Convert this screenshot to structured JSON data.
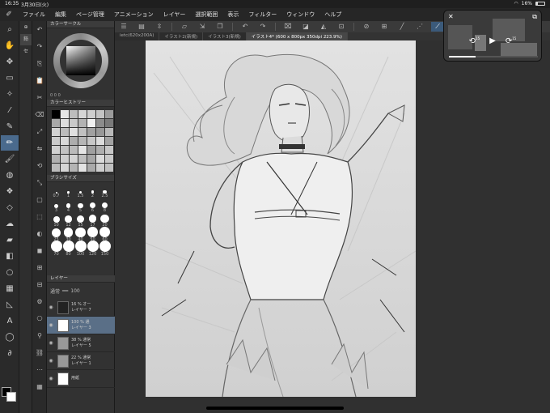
{
  "status": {
    "time": "16:35",
    "date": "3月30日(火)",
    "battery": "16%"
  },
  "menu": [
    "ファイル",
    "編集",
    "ページ管理",
    "アニメーション",
    "レイヤー",
    "選択範囲",
    "表示",
    "フィルター",
    "ウィンドウ",
    "ヘルプ"
  ],
  "tabs": [
    "ietc(620x200A)",
    "イラスト2(新規)",
    "イラスト3(新規)",
    "イラスト4* (600 x 800px 350dpi 223.9%)"
  ],
  "palette": {
    "color_circle_title": "カラーサークル",
    "history_title": "カラーヒストリー",
    "brush_title": "ブラシサイズ",
    "layer_title": "レイヤー",
    "blend_mode": "通常",
    "opacity": "100",
    "color_values": [
      "0",
      "0",
      "0"
    ]
  },
  "brush_sizes": [
    "0.7",
    "1",
    "1.5",
    "2",
    "2.5",
    "3",
    "4",
    "5",
    "6",
    "8",
    "10",
    "12",
    "15",
    "17",
    "20",
    "25",
    "30",
    "40",
    "50",
    "60",
    "70",
    "80",
    "100",
    "120",
    "150",
    "170",
    "200",
    "250",
    "300"
  ],
  "layers": [
    {
      "opacity_mode": "16 % オー",
      "name": "レイヤー 7",
      "thumb": "dark",
      "active": false
    },
    {
      "opacity_mode": "100 % 通",
      "name": "レイヤー 3",
      "thumb": "white",
      "active": true
    },
    {
      "opacity_mode": "38 % 通常",
      "name": "レイヤー 5",
      "thumb": "gray",
      "active": false
    },
    {
      "opacity_mode": "22 % 通常",
      "name": "レイヤー 1",
      "thumb": "gray",
      "active": false
    },
    {
      "opacity_mode": "",
      "name": "用紙",
      "thumb": "white",
      "active": false
    }
  ],
  "colors": {
    "accent": "#4a6a8d",
    "active_layer": "#5a6f87"
  },
  "pip": {
    "rewind_label": "15",
    "forward_label": "15"
  }
}
